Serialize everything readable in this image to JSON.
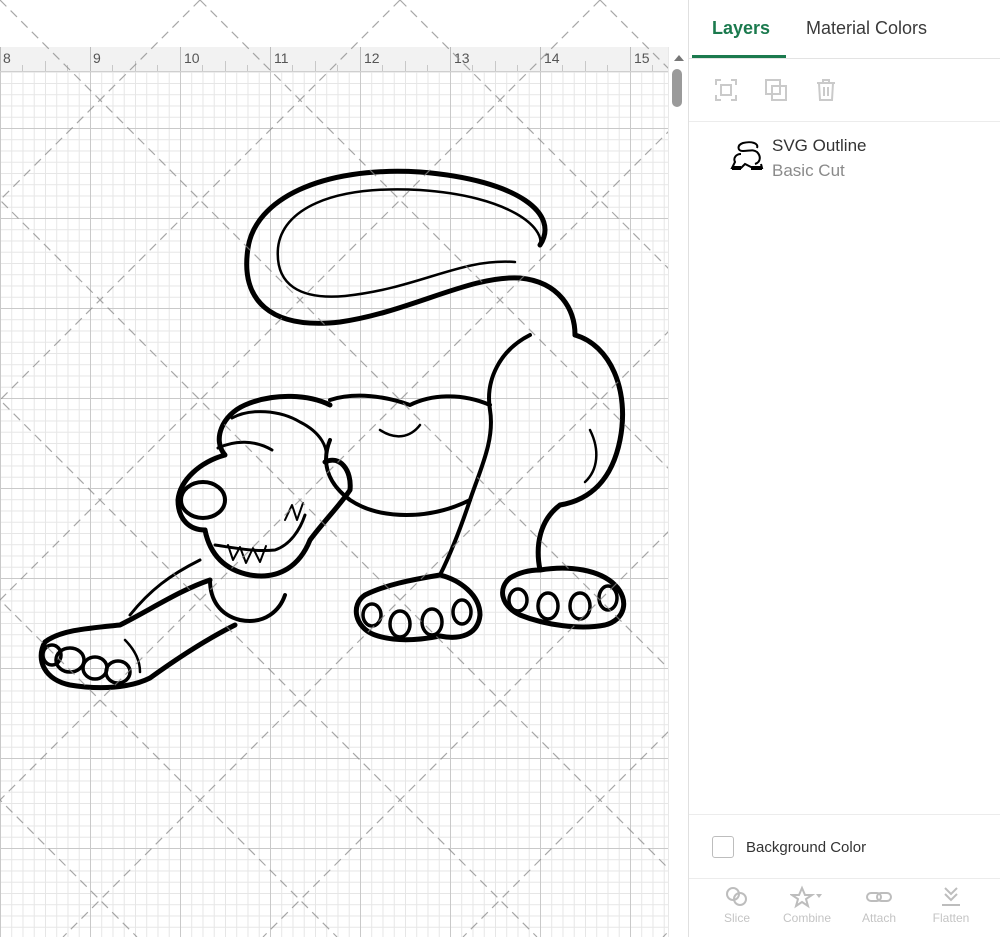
{
  "ruler": {
    "labels": [
      "8",
      "9",
      "10",
      "11",
      "12",
      "13",
      "14",
      "15"
    ]
  },
  "panel": {
    "tabs": {
      "layers": "Layers",
      "material_colors": "Material Colors"
    },
    "toolbar": {
      "icons": [
        "group-icon",
        "duplicate-icon",
        "delete-icon"
      ]
    },
    "layer": {
      "name": "SVG Outline",
      "subtitle": "Basic Cut"
    },
    "background_color_label": "Background Color",
    "bottom_bar": {
      "slice": "Slice",
      "combine": "Combine",
      "attach": "Attach",
      "flatten": "Flatten"
    }
  },
  "colors": {
    "accent": "#1b7a4e",
    "ruler_bg": "#f2f2f2"
  }
}
